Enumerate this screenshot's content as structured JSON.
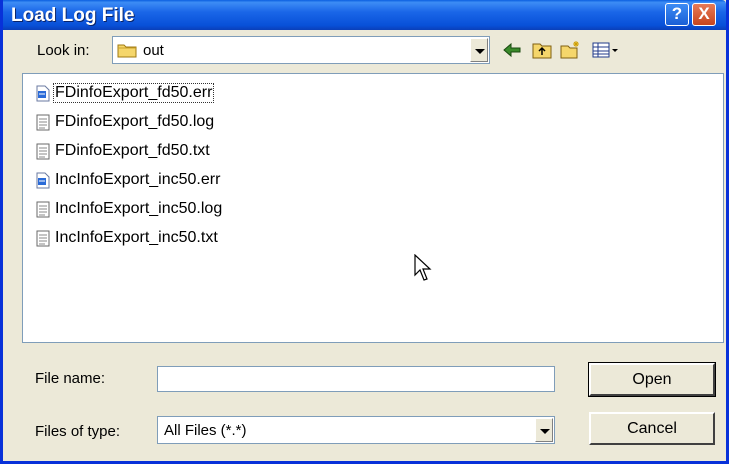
{
  "window": {
    "title": "Load Log File"
  },
  "title_buttons": {
    "help_label": "?",
    "close_label": "X"
  },
  "look_in": {
    "label": "Look in:",
    "value": "out"
  },
  "toolbar": {
    "icons": [
      "back-arrow-icon",
      "up-folder-icon",
      "new-folder-icon",
      "view-menu-icon"
    ]
  },
  "files": [
    {
      "name": "FDinfoExport_fd50.err",
      "icon": "err-file-icon"
    },
    {
      "name": "FDinfoExport_fd50.log",
      "icon": "text-file-icon"
    },
    {
      "name": "FDinfoExport_fd50.txt",
      "icon": "text-file-icon"
    },
    {
      "name": "IncInfoExport_inc50.err",
      "icon": "err-file-icon"
    },
    {
      "name": "IncInfoExport_inc50.log",
      "icon": "text-file-icon"
    },
    {
      "name": "IncInfoExport_inc50.txt",
      "icon": "text-file-icon"
    }
  ],
  "file_name": {
    "label": "File name:",
    "value": ""
  },
  "file_type": {
    "label": "Files of type:",
    "value": "All Files (*.*)"
  },
  "buttons": {
    "open_label": "Open",
    "cancel_label": "Cancel"
  }
}
